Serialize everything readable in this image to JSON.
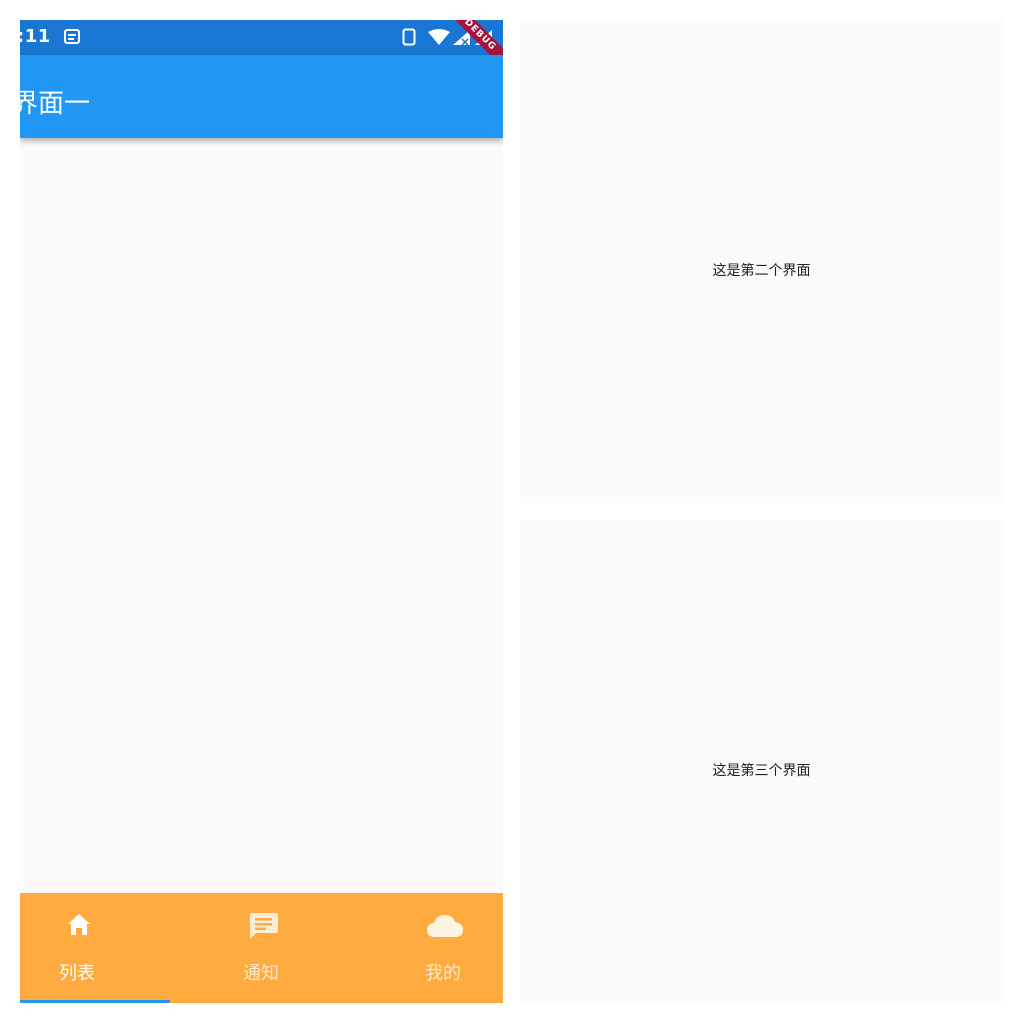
{
  "status_bar": {
    "time": ":11",
    "debug_label": "DEBUG",
    "icons": [
      "notification-icon",
      "phone-icon",
      "wifi-icon",
      "signal-icon",
      "signal-icon"
    ]
  },
  "screen_one": {
    "app_bar_title": "界面一",
    "bottom_nav": {
      "items": [
        {
          "label": "列表",
          "icon": "home-icon",
          "active": true
        },
        {
          "label": "通知",
          "icon": "message-icon",
          "active": false
        },
        {
          "label": "我的",
          "icon": "cloud-icon",
          "active": false
        }
      ],
      "background": "#ffab40",
      "indicator_color": "#2196f3"
    },
    "app_bar_color": "#2196f3",
    "status_bar_color": "#1976d2"
  },
  "screen_two": {
    "text": "这是第二个界面"
  },
  "screen_three": {
    "text": "这是第三个界面"
  }
}
